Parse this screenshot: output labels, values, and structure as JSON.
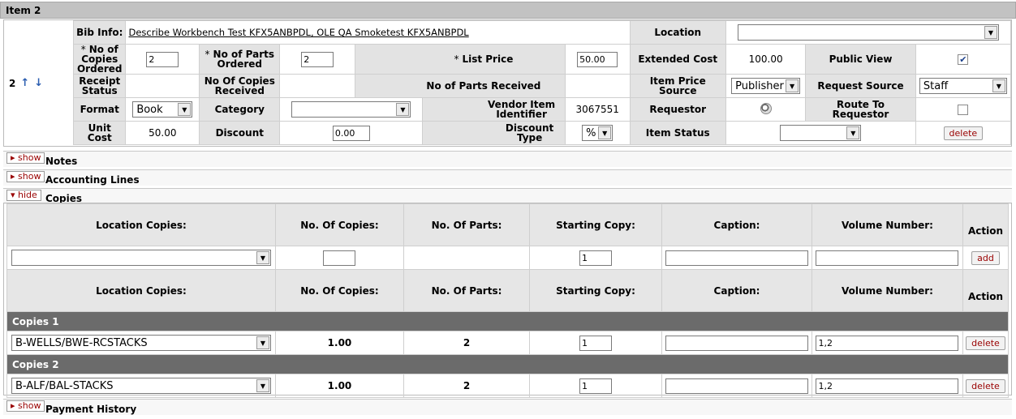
{
  "item": {
    "header": "Item 2",
    "number": "2",
    "bib_label": "Bib Info:",
    "bib_value": "Describe Workbench Test KFX5ANBPDL, OLE QA Smoketest KFX5ANBPDL",
    "location_label": "Location",
    "location_value": "",
    "copies_ordered_label": "No of Copies Ordered",
    "copies_ordered_value": "2",
    "parts_ordered_label": "No of Parts Ordered",
    "parts_ordered_value": "2",
    "list_price_label": "List Price",
    "list_price_value": "50.00",
    "extended_cost_label": "Extended Cost",
    "extended_cost_value": "100.00",
    "public_view_label": "Public View",
    "public_view_checked": true,
    "receipt_status_label": "Receipt Status",
    "copies_received_label": "No Of Copies Received",
    "parts_received_label": "No of Parts Received",
    "item_price_source_label": "Item Price Source",
    "item_price_source_value": "Publisher",
    "request_source_label": "Request Source",
    "request_source_value": "Staff",
    "format_label": "Format",
    "format_value": "Book",
    "category_label": "Category",
    "category_value": "",
    "vendor_item_label": "Vendor Item Identifier",
    "vendor_item_value": "3067551",
    "requestor_label": "Requestor",
    "route_label": "Route To Requestor",
    "route_checked": false,
    "unit_cost_label": "Unit Cost",
    "unit_cost_value": "50.00",
    "discount_label": "Discount",
    "discount_value": "0.00",
    "discount_type_label": "Discount Type",
    "discount_type_value": "%",
    "item_status_label": "Item Status",
    "item_status_value": "",
    "delete_label": "delete"
  },
  "sections": {
    "show": "show",
    "hide": "hide",
    "notes": "Notes",
    "accounting": "Accounting Lines",
    "copies": "Copies",
    "payment": "Payment History"
  },
  "copies_table": {
    "headers": [
      "Location Copies:",
      "No. Of Copies:",
      "No. Of Parts:",
      "Starting Copy:",
      "Caption:",
      "Volume Number:",
      "Action"
    ],
    "new_row": {
      "location": "",
      "copies": "",
      "starting_copy": "1",
      "caption": "",
      "volume": "",
      "add": "add"
    },
    "groups": [
      {
        "title": "Copies 1",
        "location": "B-WELLS/BWE-RCSTACKS",
        "copies": "1.00",
        "parts": "2",
        "starting_copy": "1",
        "caption": "",
        "volume": "1,2",
        "action": "delete"
      },
      {
        "title": "Copies 2",
        "location": "B-ALF/BAL-STACKS",
        "copies": "1.00",
        "parts": "2",
        "starting_copy": "1",
        "caption": "",
        "volume": "1,2",
        "action": "delete"
      }
    ]
  }
}
